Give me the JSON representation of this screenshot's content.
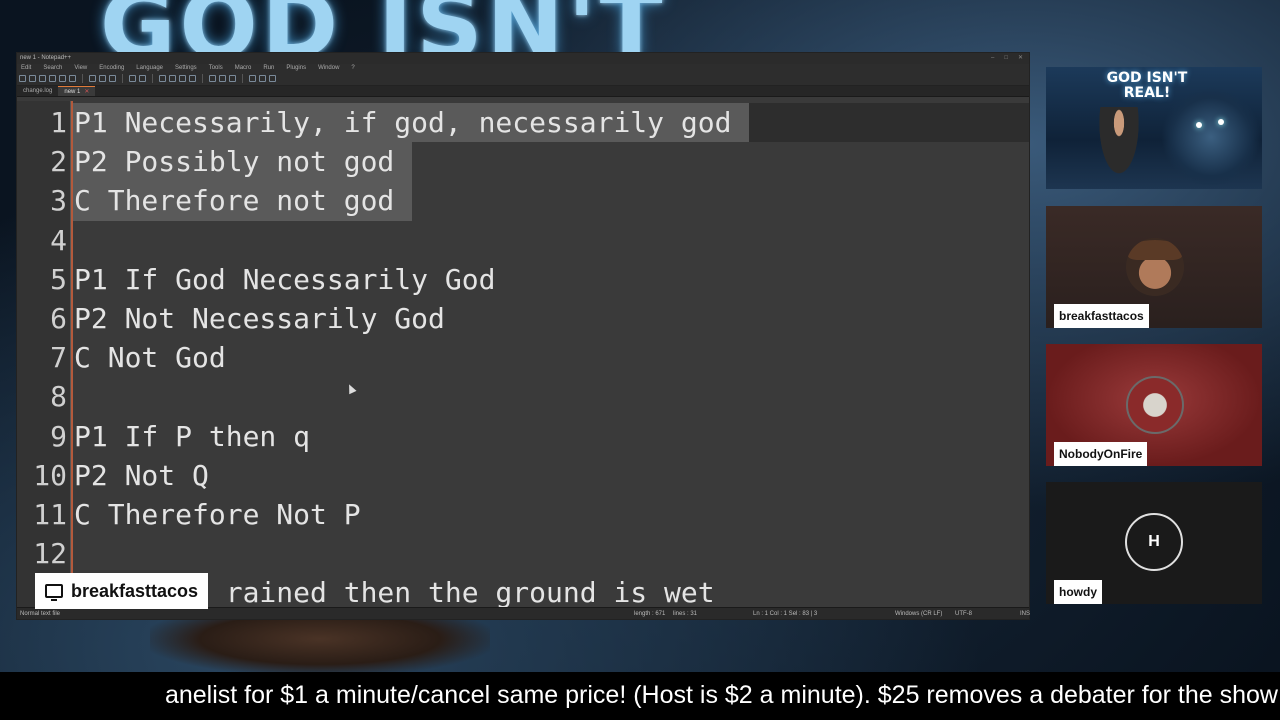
{
  "banner": {
    "title": "GOD ISN'T"
  },
  "editor": {
    "title": "new 1 - Notepad++",
    "menu": [
      "Edit",
      "Search",
      "View",
      "Encoding",
      "Language",
      "Settings",
      "Tools",
      "Macro",
      "Run",
      "Plugins",
      "Window",
      "?"
    ],
    "tabs": [
      {
        "label": "change.log",
        "active": false
      },
      {
        "label": "new 1",
        "active": true
      }
    ],
    "lines": [
      {
        "num": "1",
        "text": "P1 Necessarily, if god, necessarily god",
        "selected": true
      },
      {
        "num": "2",
        "text": "P2 Possibly not god",
        "selected": true
      },
      {
        "num": "3",
        "text": "C Therefore not god",
        "selected": true
      },
      {
        "num": "4",
        "text": "",
        "selected": false
      },
      {
        "num": "5",
        "text": "P1 If God Necessarily God",
        "selected": false
      },
      {
        "num": "6",
        "text": "P2 Not Necessarily God",
        "selected": false
      },
      {
        "num": "7",
        "text": "C Not God",
        "selected": false
      },
      {
        "num": "8",
        "text": "",
        "selected": false
      },
      {
        "num": "9",
        "text": "P1 If P then q",
        "selected": false
      },
      {
        "num": "10",
        "text": "P2 Not Q",
        "selected": false
      },
      {
        "num": "11",
        "text": "C Therefore Not P",
        "selected": false
      },
      {
        "num": "12",
        "text": "",
        "selected": false
      },
      {
        "num": "13",
        "text": "P1 If it rained then the ground is wet",
        "selected": false
      }
    ],
    "status": {
      "file_type": "Normal text file",
      "length": "length : 671",
      "lines": "lines : 31",
      "position": "Ln : 1    Col : 1    Sel : 83 | 3",
      "eol": "Windows (CR LF)",
      "encoding": "UTF-8",
      "mode": "INS"
    }
  },
  "speaker_tag": {
    "name": "breakfasttacos",
    "icon": "monitor-icon"
  },
  "thumbnail": {
    "title": "GOD ISN'T REAL!"
  },
  "participants": [
    {
      "name": "breakfasttacos"
    },
    {
      "name": "NobodyOnFire"
    },
    {
      "name": "howdy",
      "initial": "H"
    }
  ],
  "ticker": {
    "text": "anelist for $1 a minute/cancel same price! (Host is $2 a minute). $25 removes a debater for the show"
  }
}
